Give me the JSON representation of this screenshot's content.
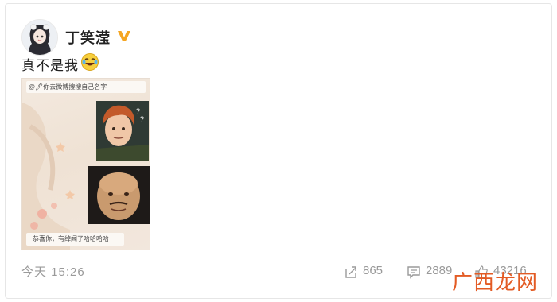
{
  "post": {
    "username": "丁笑滢",
    "text": "真不是我",
    "time": "今天 15:26",
    "verified_badge": "yellow-v-badge",
    "emoji": "laughing-tears-emoji"
  },
  "meme": {
    "top_caption": "@🖊你去微博搜搜自己名字",
    "bottom_caption": "恭喜你，有绰闻了哈哈哈哈"
  },
  "actions": {
    "share_count": "865",
    "comment_count": "2889",
    "like_count": "43216"
  },
  "watermark": "广西龙网",
  "colors": {
    "badge": "#f5a623",
    "meta_text": "#9a9a9a",
    "watermark": "#e35b24"
  }
}
